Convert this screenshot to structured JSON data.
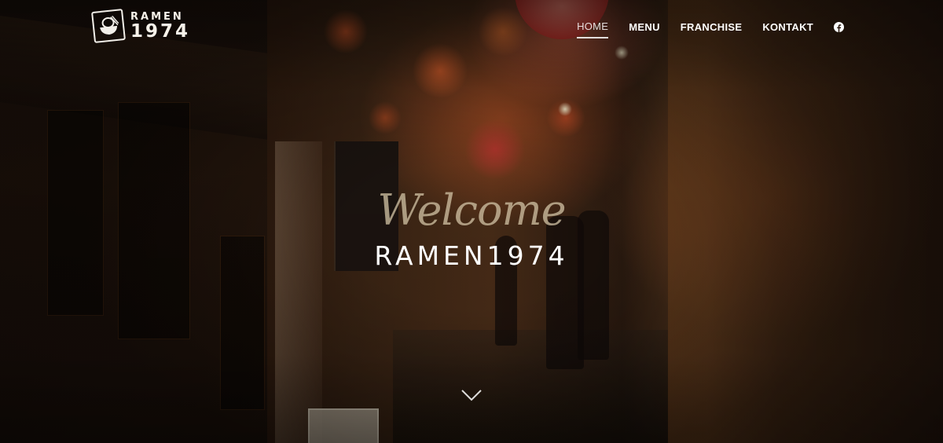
{
  "logo": {
    "line1": "RAMEN",
    "line2": "1974",
    "icon": "ramen-bowl-icon"
  },
  "nav": {
    "items": [
      {
        "label": "HOME",
        "active": true
      },
      {
        "label": "MENU",
        "active": false
      },
      {
        "label": "FRANCHISE",
        "active": false
      },
      {
        "label": "KONTAKT",
        "active": false
      }
    ],
    "social_icon": "facebook-icon"
  },
  "hero": {
    "script_text": "Welcome",
    "title": "RAMEN1974",
    "scroll_icon": "chevron-down-icon"
  },
  "colors": {
    "nav_text": "#ffffff",
    "script_text": "#cdbea0",
    "title_text": "#ffffff",
    "tint": "#4a2d18"
  }
}
